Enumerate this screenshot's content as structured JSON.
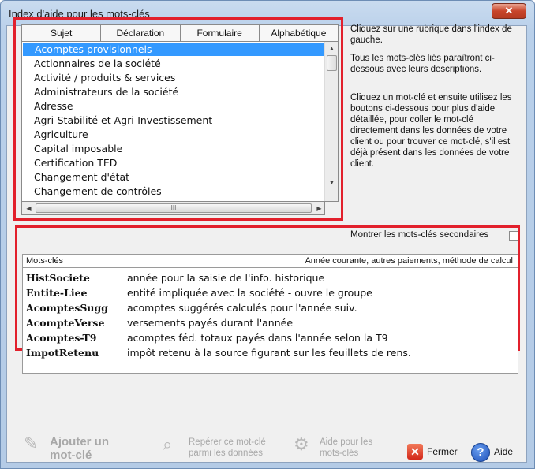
{
  "window": {
    "title": "Index d'aide pour les mots-clés",
    "close_glyph": "✕"
  },
  "tabs": [
    "Sujet",
    "Déclaration",
    "Formulaire",
    "Alphabétique"
  ],
  "topics": [
    "Acomptes provisionnels",
    "Actionnaires de la société",
    "Activité / produits & services",
    "Administrateurs de la société",
    "Adresse",
    "Agri-Stabilité et Agri-Investissement",
    "Agriculture",
    "Capital imposable",
    "Certification TED",
    "Changement d'état",
    "Changement de contrôles"
  ],
  "selected_topic": "Acomptes provisionnels",
  "hscroll_grip": "III",
  "help": {
    "p1": "Cliquez sur une rubrique dans l'index de gauche.",
    "p2": "Tous les mots-clés liés paraîtront ci-dessous avec leurs descriptions.",
    "p3": "Cliquez un mot-clé et ensuite utilisez les boutons ci-dessous pour plus d'aide détaillée, pour coller le mot-clé directement dans les données de votre client ou pour trouver ce mot-clé, s'il est déjà présent dans les données de votre client."
  },
  "show_secondary_label": "Montrer les mots-clés secondaires",
  "show_secondary_checked": false,
  "keywords": {
    "header_left": "Mots-clés",
    "header_right": "Année courante, autres paiements, méthode de calcul",
    "rows": [
      {
        "key": "HistSociete",
        "desc": "année pour la saisie de l'info. historique"
      },
      {
        "key": "Entite-Liee",
        "desc": "entité impliquée avec la société - ouvre le groupe"
      },
      {
        "key": "AcomptesSugg",
        "desc": "acomptes suggérés calculés pour l'année suiv."
      },
      {
        "key": "AcompteVerse",
        "desc": "versements payés durant l'année"
      },
      {
        "key": "Acomptes-T9",
        "desc": "acomptes féd. totaux payés dans l'année selon la T9"
      },
      {
        "key": "ImpotRetenu",
        "desc": "impôt retenu à la source figurant sur les feuillets de rens."
      }
    ]
  },
  "buttons": {
    "add_line1": "Ajouter un",
    "add_line2": "mot-clé",
    "find_line1": "Repérer ce mot-clé",
    "find_line2": "parmi les données",
    "help_line1": "Aide pour les",
    "help_line2": "mots-clés",
    "close_label": "Fermer",
    "aide_label": "Aide"
  }
}
